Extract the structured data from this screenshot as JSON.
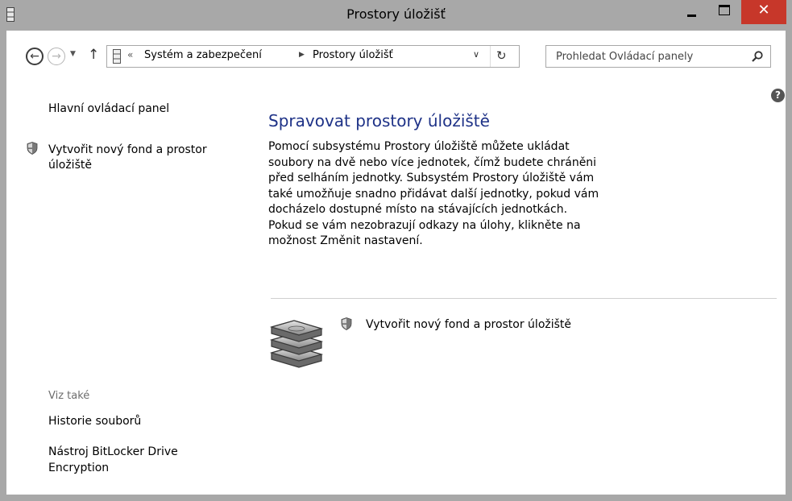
{
  "window": {
    "title": "Prostory úložišť",
    "close_glyph": "✕",
    "icons": {
      "app": "storage-stack-icon",
      "minimize": "minimize-icon",
      "maximize": "maximize-icon",
      "close": "close-icon"
    }
  },
  "nav": {
    "back_glyph": "←",
    "forward_glyph": "→",
    "recent_glyph": "▼",
    "up_glyph": "↑",
    "breadcrumb_overflow": "«",
    "breadcrumbs": [
      "Systém a zabezpečení",
      "Prostory úložišť"
    ],
    "crumb_arrow": "▶",
    "dropdown_glyph": "∨",
    "refresh_glyph": "↻",
    "search": {
      "placeholder": "Prohledat Ovládací panely",
      "value": ""
    }
  },
  "help_glyph": "?",
  "sidebar": {
    "home_link": "Hlavní ovládací panel",
    "create_link": "Vytvořit nový fond a prostor úložiště",
    "see_also_title": "Viz také",
    "see_also_links": [
      "Historie souborů",
      "Nástroj BitLocker Drive Encryption"
    ]
  },
  "main": {
    "title": "Spravovat prostory úložiště",
    "description": "Pomocí subsystému Prostory úložiště můžete ukládat soubory na dvě nebo více jednotek, čímž budete chráněni před selháním jednotky. Subsystém Prostory úložiště vám také umožňuje snadno přidávat další jednotky, pokud vám docházelo dostupné místo na stávajících jednotkách. Pokud se vám nezobrazují odkazy na úlohy, klikněte na možnost Změnit nastavení.",
    "create_link": "Vytvořit nový fond a prostor úložiště"
  },
  "colors": {
    "titlebar": "#a8a8a8",
    "close_button": "#c7372a",
    "heading": "#1e3287",
    "see_also": "#6d6d6d"
  }
}
